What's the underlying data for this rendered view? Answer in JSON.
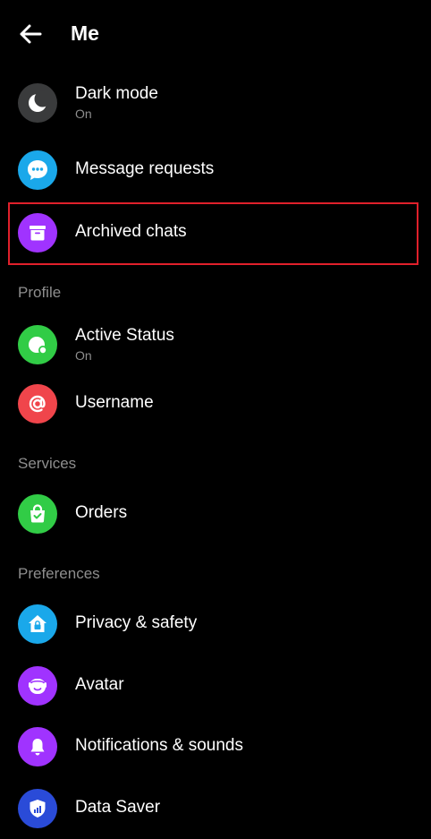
{
  "header": {
    "title": "Me"
  },
  "sections": {
    "profile": "Profile",
    "services": "Services",
    "preferences": "Preferences"
  },
  "items": {
    "dark_mode": {
      "label": "Dark mode",
      "sub": "On"
    },
    "message_requests": {
      "label": "Message requests"
    },
    "archived_chats": {
      "label": "Archived chats"
    },
    "active_status": {
      "label": "Active Status",
      "sub": "On"
    },
    "username": {
      "label": "Username"
    },
    "orders": {
      "label": "Orders"
    },
    "privacy": {
      "label": "Privacy & safety"
    },
    "avatar": {
      "label": "Avatar"
    },
    "notifications": {
      "label": "Notifications & sounds"
    },
    "data_saver": {
      "label": "Data Saver"
    }
  },
  "colors": {
    "dark_mode": "#3a3b3c",
    "message_requests": "#1aa8ea",
    "archived_chats": "#a033ff",
    "active_status": "#31cc46",
    "username": "#f0454b",
    "orders": "#31cc46",
    "privacy": "#1aa8ea",
    "avatar": "#a033ff",
    "notifications": "#a033ff",
    "data_saver": "#2a4bd8",
    "highlight": "#e0202b"
  }
}
